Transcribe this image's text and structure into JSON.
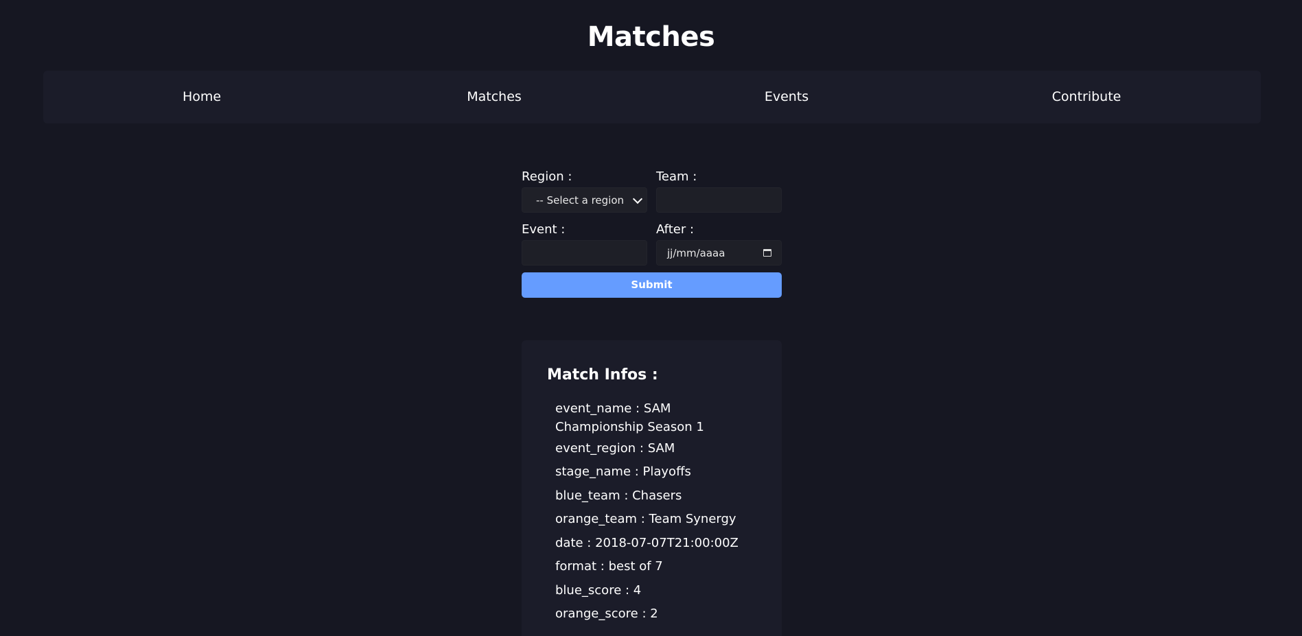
{
  "page": {
    "title": "Matches"
  },
  "nav": {
    "items": [
      {
        "label": "Home"
      },
      {
        "label": "Matches"
      },
      {
        "label": "Events"
      },
      {
        "label": "Contribute"
      }
    ]
  },
  "form": {
    "region": {
      "label": "Region :",
      "selected": "-- Select a region"
    },
    "team": {
      "label": "Team :",
      "value": ""
    },
    "event": {
      "label": "Event :",
      "value": ""
    },
    "after": {
      "label": "After :",
      "placeholder": "jj/mm/aaaa"
    },
    "submit_label": "Submit"
  },
  "match": {
    "title": "Match Infos :",
    "fields": [
      {
        "text": "event_name : SAM Championship Season 1"
      },
      {
        "text": "event_region : SAM"
      },
      {
        "text": "stage_name : Playoffs"
      },
      {
        "text": "blue_team : Chasers"
      },
      {
        "text": "orange_team : Team Synergy"
      },
      {
        "text": "date : 2018-07-07T21:00:00Z"
      },
      {
        "text": "format : best of 7"
      },
      {
        "text": "blue_score : 4"
      },
      {
        "text": "orange_score : 2"
      }
    ]
  },
  "colors": {
    "background": "#161722",
    "panel": "#1b1c29",
    "input": "#1e1f27",
    "accent": "#659cff",
    "text": "#ffffff"
  }
}
